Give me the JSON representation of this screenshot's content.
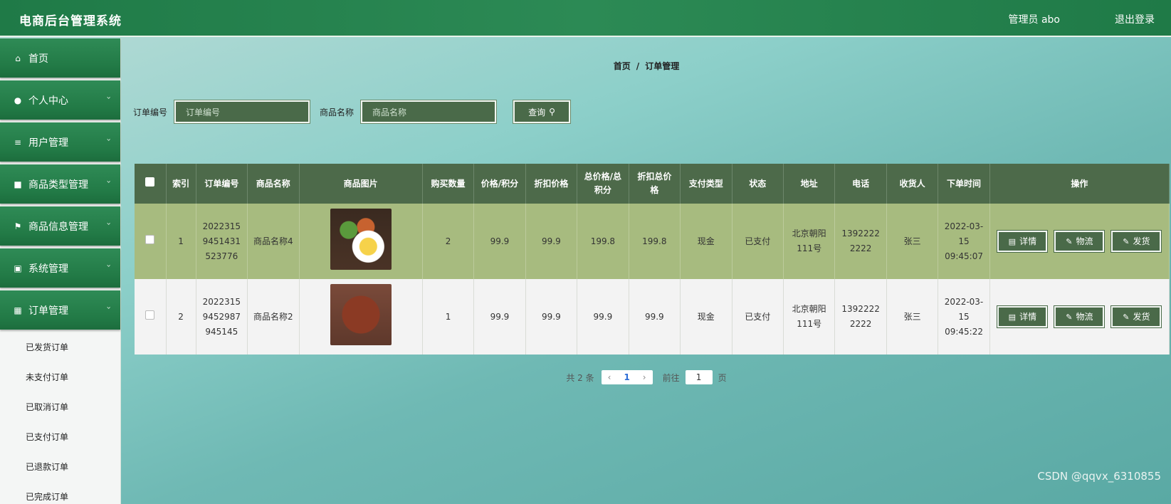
{
  "header": {
    "title": "电商后台管理系统",
    "user": "管理员 abo",
    "logout": "退出登录"
  },
  "sidebar": {
    "items": [
      {
        "label": "首页",
        "icon": "home-icon",
        "glyph": "⌂",
        "chevron": false
      },
      {
        "label": "个人中心",
        "icon": "user-icon",
        "glyph": "●",
        "chevron": true
      },
      {
        "label": "用户管理",
        "icon": "list-icon",
        "glyph": "≡",
        "chevron": true
      },
      {
        "label": "商品类型管理",
        "icon": "briefcase-icon",
        "glyph": "■",
        "chevron": true
      },
      {
        "label": "商品信息管理",
        "icon": "flag-icon",
        "glyph": "⚑",
        "chevron": true
      },
      {
        "label": "系统管理",
        "icon": "clipboard-icon",
        "glyph": "▣",
        "chevron": true
      },
      {
        "label": "订单管理",
        "icon": "grid-icon",
        "glyph": "▦",
        "chevron": true
      }
    ],
    "submenu": [
      "已发货订单",
      "未支付订单",
      "已取消订单",
      "已支付订单",
      "已退款订单",
      "已完成订单"
    ]
  },
  "breadcrumb": {
    "home": "首页",
    "sep": "/",
    "current": "订单管理"
  },
  "search": {
    "order_label": "订单编号",
    "order_placeholder": "订单编号",
    "product_label": "商品名称",
    "product_placeholder": "商品名称",
    "query_label": "查询"
  },
  "table": {
    "headers": [
      "索引",
      "订单编号",
      "商品名称",
      "商品图片",
      "购买数量",
      "价格/积分",
      "折扣价格",
      "总价格/总积分",
      "折扣总价格",
      "支付类型",
      "状态",
      "地址",
      "电话",
      "收货人",
      "下单时间",
      "操作"
    ],
    "rows": [
      {
        "index": "1",
        "order_no": "20223159451431523776",
        "product": "商品名称4",
        "qty": "2",
        "price": "99.9",
        "discount": "99.9",
        "total": "199.8",
        "discount_total": "199.8",
        "pay_type": "现金",
        "status": "已支付",
        "address": "北京朝阳111号",
        "phone": "13922222222",
        "receiver": "张三",
        "time": "2022-03-15 09:45:07"
      },
      {
        "index": "2",
        "order_no": "20223159452987945145",
        "product": "商品名称2",
        "qty": "1",
        "price": "99.9",
        "discount": "99.9",
        "total": "99.9",
        "discount_total": "99.9",
        "pay_type": "现金",
        "status": "已支付",
        "address": "北京朝阳111号",
        "phone": "13922222222",
        "receiver": "张三",
        "time": "2022-03-15 09:45:22"
      }
    ],
    "actions": {
      "detail": "详情",
      "logistics": "物流",
      "ship": "发货"
    }
  },
  "pagination": {
    "total": "共 2 条",
    "prev": "‹",
    "current": "1",
    "next": "›",
    "goto": "前往",
    "goto_value": "1",
    "page_unit": "页"
  },
  "watermark": "CSDN @qqvx_6310855"
}
